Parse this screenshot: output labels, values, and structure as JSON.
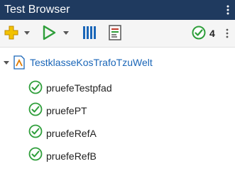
{
  "window": {
    "title": "Test Browser"
  },
  "toolbar": {
    "add_label": "",
    "run_label": "",
    "passed_count": "4"
  },
  "tree": {
    "root": {
      "label": "TestklasseKosTrafoTzuWelt"
    },
    "children": [
      {
        "label": "pruefeTestpfad",
        "status": "passed"
      },
      {
        "label": "pruefePT",
        "status": "passed"
      },
      {
        "label": "pruefeRefA",
        "status": "passed"
      },
      {
        "label": "pruefeRefB",
        "status": "passed"
      }
    ]
  },
  "colors": {
    "titlebar": "#1f3a5f",
    "passed": "#2e9e3a",
    "accent": "#1a66b8"
  }
}
